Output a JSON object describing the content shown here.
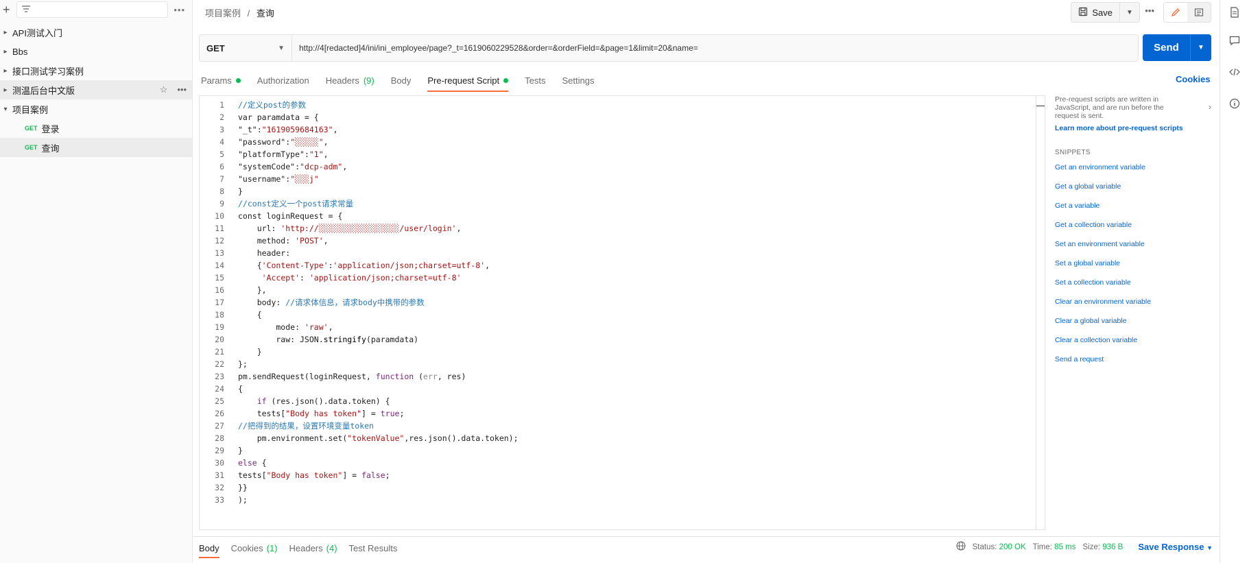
{
  "sidebar": {
    "filter_placeholder": "",
    "items": [
      {
        "label": "API测试入门",
        "type": "collection"
      },
      {
        "label": "Bbs",
        "type": "collection"
      },
      {
        "label": "接口测试学习案例",
        "type": "collection"
      },
      {
        "label": "测温后台中文版",
        "type": "collection",
        "highlighted": true
      },
      {
        "label": "项目案例",
        "type": "collection",
        "expanded": true
      }
    ],
    "requests": [
      {
        "method": "GET",
        "label": "登录"
      },
      {
        "method": "GET",
        "label": "查询"
      }
    ]
  },
  "header": {
    "breadcrumb_parent": "项目案例",
    "breadcrumb_sep": "/",
    "breadcrumb_current": "查询",
    "save_label": "Save"
  },
  "request": {
    "method": "GET",
    "url": "http://4[redacted]4/ini/ini_employee/page?_t=1619060229528&order=&orderField=&page=1&limit=20&name=",
    "send_label": "Send"
  },
  "tabs": {
    "params": "Params",
    "authorization": "Authorization",
    "headers": "Headers",
    "headers_count": "(9)",
    "body": "Body",
    "prerequest": "Pre-request Script",
    "tests": "Tests",
    "settings": "Settings",
    "cookies": "Cookies"
  },
  "code_lines": [
    [
      {
        "t": "//定义post的参数",
        "c": "#2a7ab0"
      }
    ],
    [
      {
        "t": "var paramdata = {",
        "c": "#212121"
      }
    ],
    [
      {
        "t": "\"_t\"",
        "c": "#212121"
      },
      {
        "t": ":",
        "c": "#212121"
      },
      {
        "t": "\"1619059684163\"",
        "c": "#a31515"
      },
      {
        "t": ",",
        "c": "#212121"
      }
    ],
    [
      {
        "t": "\"password\"",
        "c": "#212121"
      },
      {
        "t": ":",
        "c": "#212121"
      },
      {
        "t": "\"░░░░░\"",
        "c": "#a31515"
      },
      {
        "t": ",",
        "c": "#212121"
      }
    ],
    [
      {
        "t": "\"platformType\"",
        "c": "#212121"
      },
      {
        "t": ":",
        "c": "#212121"
      },
      {
        "t": "\"1\"",
        "c": "#a31515"
      },
      {
        "t": ",",
        "c": "#212121"
      }
    ],
    [
      {
        "t": "\"systemCode\"",
        "c": "#212121"
      },
      {
        "t": ":",
        "c": "#212121"
      },
      {
        "t": "\"dcp-adm\"",
        "c": "#a31515"
      },
      {
        "t": ",",
        "c": "#212121"
      }
    ],
    [
      {
        "t": "\"username\"",
        "c": "#212121"
      },
      {
        "t": ":",
        "c": "#212121"
      },
      {
        "t": "\"░░░j\"",
        "c": "#a31515"
      }
    ],
    [
      {
        "t": "}",
        "c": "#212121"
      }
    ],
    [
      {
        "t": "//const定义一个post请求常量",
        "c": "#2a7ab0"
      }
    ],
    [
      {
        "t": "const loginRequest = {",
        "c": "#212121"
      }
    ],
    [
      {
        "t": "    url: ",
        "c": "#212121"
      },
      {
        "t": "'http://░░░░░░░░░░░░░░░░░/user/login'",
        "c": "#a31515"
      },
      {
        "t": ",",
        "c": "#212121"
      }
    ],
    [
      {
        "t": "    method: ",
        "c": "#212121"
      },
      {
        "t": "'POST'",
        "c": "#a31515"
      },
      {
        "t": ",",
        "c": "#212121"
      }
    ],
    [
      {
        "t": "    header:",
        "c": "#212121"
      }
    ],
    [
      {
        "t": "    {",
        "c": "#212121"
      },
      {
        "t": "'Content-Type'",
        "c": "#a31515"
      },
      {
        "t": ":",
        "c": "#212121"
      },
      {
        "t": "'application/json;charset=utf-8'",
        "c": "#a31515"
      },
      {
        "t": ",",
        "c": "#212121"
      }
    ],
    [
      {
        "t": "     ",
        "c": "#212121"
      },
      {
        "t": "'Accept'",
        "c": "#a31515"
      },
      {
        "t": ": ",
        "c": "#212121"
      },
      {
        "t": "'application/json;charset=utf-8'",
        "c": "#a31515"
      }
    ],
    [
      {
        "t": "    },",
        "c": "#212121"
      }
    ],
    [
      {
        "t": "    body: ",
        "c": "#212121"
      },
      {
        "t": "//请求体信息，请求body中携带的参数",
        "c": "#2a7ab0"
      }
    ],
    [
      {
        "t": "    {",
        "c": "#212121"
      }
    ],
    [
      {
        "t": "        mode: ",
        "c": "#212121"
      },
      {
        "t": "'raw'",
        "c": "#a31515"
      },
      {
        "t": ",",
        "c": "#212121"
      }
    ],
    [
      {
        "t": "        raw: JSON.",
        "c": "#212121"
      },
      {
        "t": "stringify",
        "c": "#000000"
      },
      {
        "t": "(paramdata)",
        "c": "#212121"
      }
    ],
    [
      {
        "t": "    }",
        "c": "#212121"
      }
    ],
    [
      {
        "t": "};",
        "c": "#212121"
      }
    ],
    [
      {
        "t": "pm.sendRequest(loginRequest, ",
        "c": "#212121"
      },
      {
        "t": "function",
        "c": "#7a2b7a"
      },
      {
        "t": " (",
        "c": "#212121"
      },
      {
        "t": "err",
        "c": "#8a8a8a"
      },
      {
        "t": ", res)",
        "c": "#212121"
      }
    ],
    [
      {
        "t": "{",
        "c": "#212121"
      }
    ],
    [
      {
        "t": "    ",
        "c": "#212121"
      },
      {
        "t": "if",
        "c": "#7a2b7a"
      },
      {
        "t": " (res.json().data.token) {",
        "c": "#212121"
      }
    ],
    [
      {
        "t": "    tests[",
        "c": "#212121"
      },
      {
        "t": "\"Body has token\"",
        "c": "#a31515"
      },
      {
        "t": "] = ",
        "c": "#212121"
      },
      {
        "t": "true",
        "c": "#7a2b7a"
      },
      {
        "t": ";",
        "c": "#212121"
      }
    ],
    [
      {
        "t": "//把得到的结果，设置环境变量token",
        "c": "#2a7ab0"
      }
    ],
    [
      {
        "t": "    pm.environment.set(",
        "c": "#212121"
      },
      {
        "t": "\"tokenValue\"",
        "c": "#a31515"
      },
      {
        "t": ",res.json().data.token);",
        "c": "#212121"
      }
    ],
    [
      {
        "t": "}",
        "c": "#212121"
      }
    ],
    [
      {
        "t": "else",
        "c": "#7a2b7a"
      },
      {
        "t": " {",
        "c": "#212121"
      }
    ],
    [
      {
        "t": "tests[",
        "c": "#212121"
      },
      {
        "t": "\"Body has token\"",
        "c": "#a31515"
      },
      {
        "t": "] = ",
        "c": "#212121"
      },
      {
        "t": "false",
        "c": "#7a2b7a"
      },
      {
        "t": ";",
        "c": "#212121"
      }
    ],
    [
      {
        "t": "}}",
        "c": "#212121"
      }
    ],
    [
      {
        "t": ");",
        "c": "#212121"
      }
    ]
  ],
  "snippets": {
    "description": "Pre-request scripts are written in JavaScript, and are run before the request is sent.",
    "learn_more": "Learn more about pre-request scripts",
    "heading": "SNIPPETS",
    "items": [
      "Get an environment variable",
      "Get a global variable",
      "Get a variable",
      "Get a collection variable",
      "Set an environment variable",
      "Set a global variable",
      "Set a collection variable",
      "Clear an environment variable",
      "Clear a global variable",
      "Clear a collection variable",
      "Send a request"
    ]
  },
  "response": {
    "tabs": {
      "body": "Body",
      "cookies": "Cookies",
      "cookies_count": "(1)",
      "headers": "Headers",
      "headers_count": "(4)",
      "test_results": "Test Results"
    },
    "status_label": "Status:",
    "status_value": "200 OK",
    "time_label": "Time:",
    "time_value": "85 ms",
    "size_label": "Size:",
    "size_value": "936 B",
    "save_response": "Save Response"
  },
  "colors": {
    "accent_orange": "#ff6c37",
    "primary_blue": "#0265d2",
    "success_green": "#0cbb52"
  }
}
